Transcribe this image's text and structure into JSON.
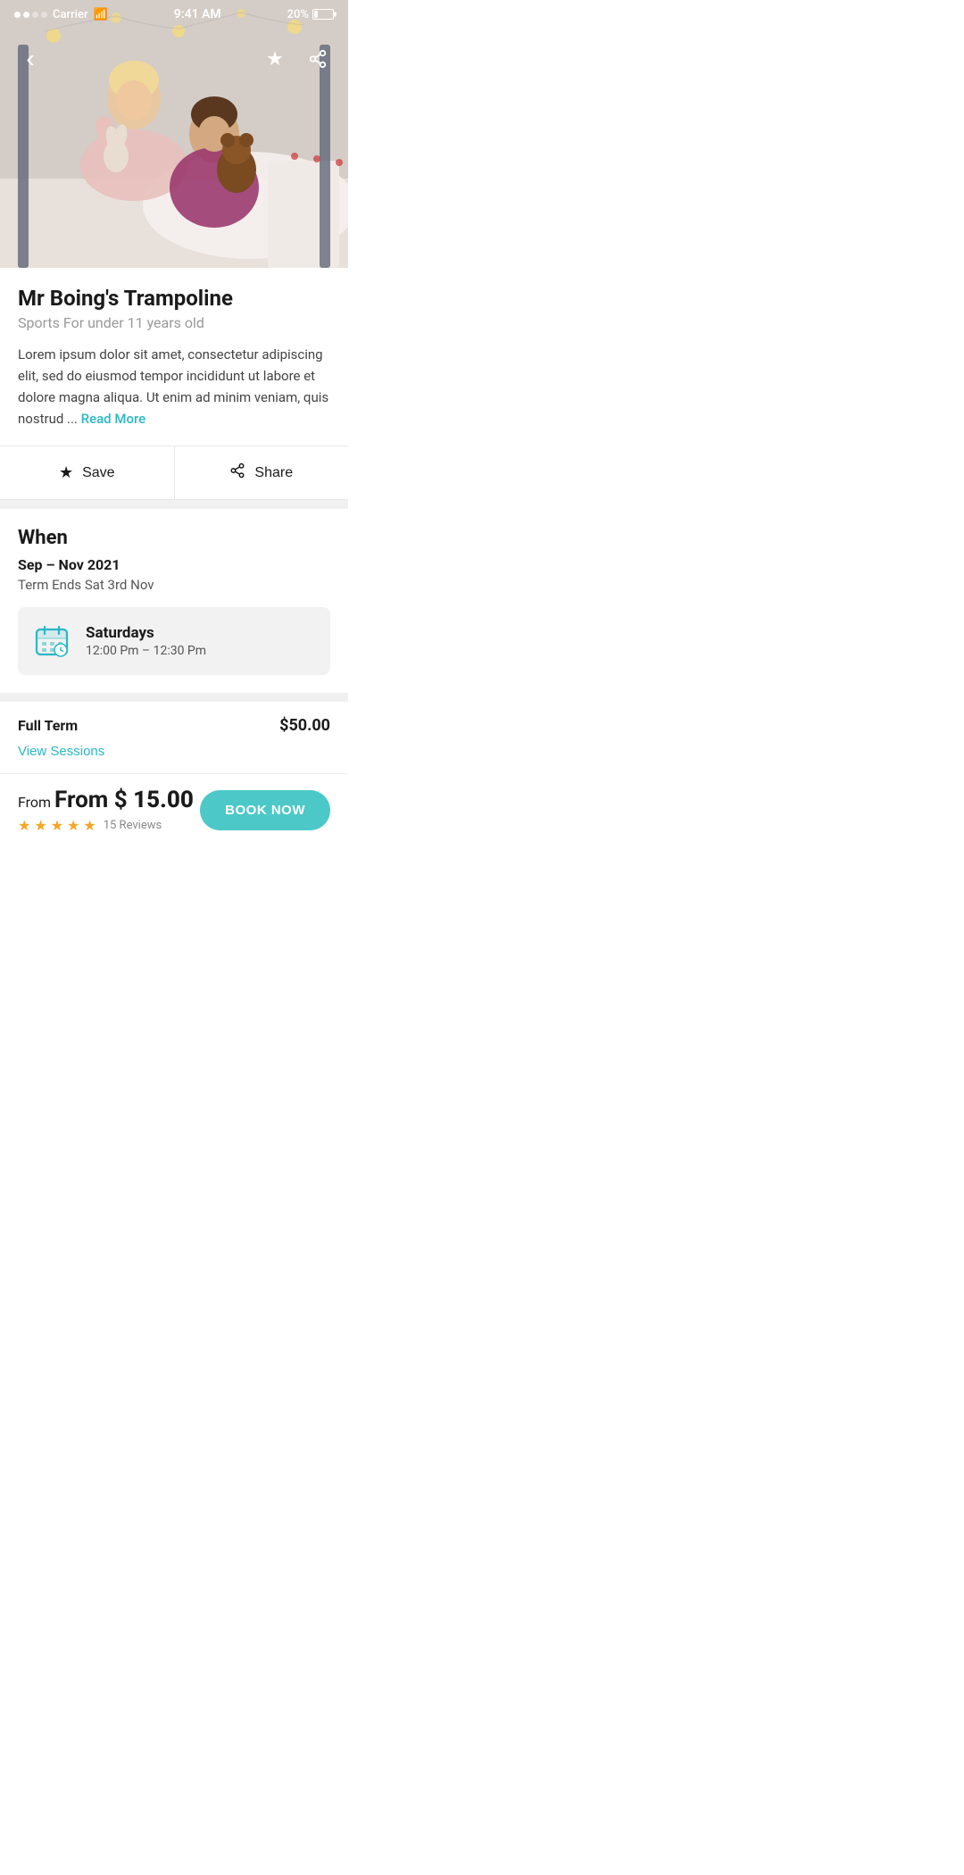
{
  "statusBar": {
    "carrier": "Carrier",
    "time": "9:41 AM",
    "battery": "20%"
  },
  "nav": {
    "back_icon": "‹",
    "bookmark_icon": "★",
    "share_icon": "⎋"
  },
  "hero": {
    "emoji": "👧🏼"
  },
  "venue": {
    "title": "Mr Boing's Trampoline",
    "subtitle": "Sports For under 11 years old",
    "description": "Lorem ipsum dolor sit amet, consectetur adipiscing elit, sed do eiusmod tempor incididunt ut labore et dolore magna aliqua. Ut enim ad minim veniam, quis nostrud ...",
    "read_more_label": "Read More"
  },
  "actions": {
    "save_label": "Save",
    "share_label": "Share",
    "save_icon": "★",
    "share_icon": "⎋"
  },
  "when": {
    "section_title": "When",
    "date_range": "Sep – Nov 2021",
    "term_ends": "Term Ends Sat 3rd Nov"
  },
  "schedule": {
    "day": "Saturdays",
    "time": "12:00 Pm – 12:30 Pm"
  },
  "pricing": {
    "label": "Full Term",
    "amount": "$50.00",
    "view_sessions_label": "View Sessions"
  },
  "bottomBar": {
    "from_label": "From $",
    "price": "15.00",
    "stars": 5,
    "reviews_count": "15 Reviews",
    "book_now_label": "BOOK NOW"
  }
}
